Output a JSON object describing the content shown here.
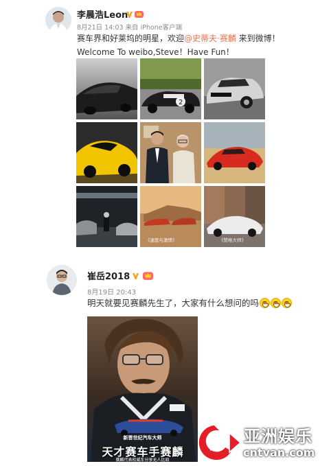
{
  "post1": {
    "author": "李晨浩Leon",
    "meta": "8月21日 14:03 来自 iPhone客户端",
    "text_before": "赛车界和好莱坞的明星，欢迎",
    "mention": "@史蒂夫·赛麟",
    "text_after": " 来到微博！Welcome To weibo,Steve！Have Fun！",
    "photo_captions": {
      "cell8": "《速度与激情》",
      "cell9": "《赞格大师》"
    }
  },
  "post2": {
    "author": "崔岳2018",
    "meta": "8月19日 20:43",
    "text": "明天就要见赛麟先生了，大家有什么想问的吗",
    "poster": {
      "subtitle_top": "新晋世纪汽车大师",
      "title": "天才赛车手赛麟",
      "subtitle_bottom": "赛麟代表权威车分享无人比肩"
    }
  },
  "watermark": {
    "cn": "亚洲娱乐",
    "en": "cntvan.com"
  },
  "colors": {
    "mention": "#eb7350",
    "vip_badge": "#f5a623",
    "watermark_red": "#e31e26"
  },
  "icons": [
    "verified-v-icon",
    "vip-crown-icon",
    "grin-emoji-icon",
    "play-logo-icon"
  ]
}
